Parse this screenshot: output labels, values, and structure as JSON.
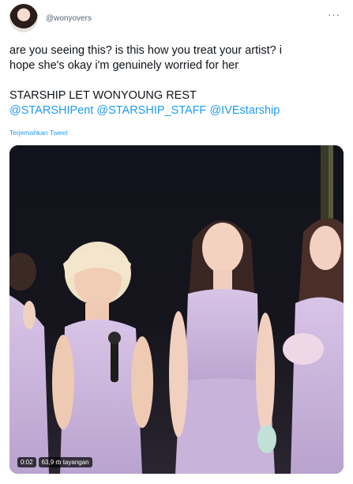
{
  "tweet": {
    "handle": "@wonyovers",
    "more_label": "···",
    "line1": "are you seeing this? is this how you treat your artist? i",
    "line2": "hope she's okay i'm genuinely worried for her",
    "line3": "STARSHIP LET WONYOUNG REST",
    "mentions": [
      "@STARSHIPent",
      "@STARSHIP_STAFF",
      "@IVEstarship"
    ],
    "translate_label": "Terjemahkan Tweet"
  },
  "video": {
    "timestamp": "0:02",
    "views": "63,9 rb tayangan"
  },
  "colors": {
    "link": "#1d9bf0",
    "secondary": "#536471",
    "text": "#0f1419"
  }
}
